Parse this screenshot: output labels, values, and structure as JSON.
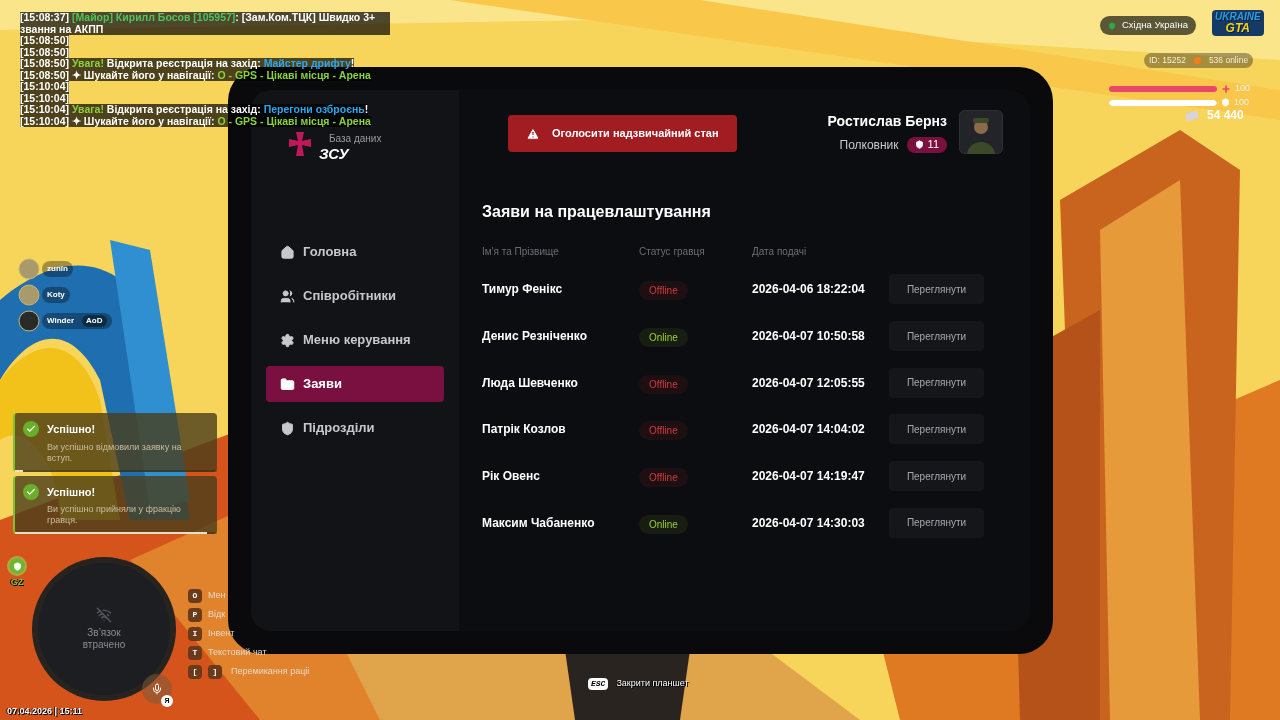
{
  "chat": [
    [
      {
        "text": "[15:08:37] ",
        "kind": "plain"
      },
      {
        "text": "[Майор]  Кирилл Босов [105957]",
        "kind": "player"
      },
      {
        "text": ": [Зам.Ком.ТЦК] Швидко 3+ звання на АКПП",
        "kind": "plain"
      }
    ],
    [
      {
        "text": "[15:08:50]",
        "kind": "plain"
      }
    ],
    [
      {
        "text": "[15:08:50]",
        "kind": "plain"
      }
    ],
    [
      {
        "text": "[15:08:50] ",
        "kind": "plain"
      },
      {
        "text": "Увага!",
        "kind": "alert"
      },
      {
        "text": " Відкрита реєстрація на захід: ",
        "kind": "plain"
      },
      {
        "text": "Майстер дрифту",
        "kind": "event"
      },
      {
        "text": "!",
        "kind": "plain"
      }
    ],
    [
      {
        "text": "[15:08:50] ✦  Шукайте його у навігації: ",
        "kind": "plain"
      },
      {
        "text": "O - GPS - Цікаві місця - Арена",
        "kind": "alert"
      }
    ],
    [
      {
        "text": "[15:10:04]",
        "kind": "plain"
      }
    ],
    [
      {
        "text": "[15:10:04]",
        "kind": "plain"
      }
    ],
    [
      {
        "text": "[15:10:04] ",
        "kind": "plain"
      },
      {
        "text": "Увага!",
        "kind": "alert"
      },
      {
        "text": " Відкрита реєстрація на захід: ",
        "kind": "plain"
      },
      {
        "text": "Перегони озброєнь",
        "kind": "event"
      },
      {
        "text": "!",
        "kind": "plain"
      }
    ],
    [
      {
        "text": "[15:10:04] ✦  Шукайте його у навігації: ",
        "kind": "plain"
      },
      {
        "text": "O - GPS - Цікаві місця - Арена",
        "kind": "alert"
      }
    ]
  ],
  "players": [
    {
      "name": "zunin"
    },
    {
      "name": "Koty"
    },
    {
      "name": "Winder",
      "tag": "AoD"
    }
  ],
  "toasts": [
    {
      "title": "Успішно!",
      "text": "Ви успішно відмовили заявку на вступ.",
      "level": 0.04
    },
    {
      "title": "Успішно!",
      "text": "Ви успішно прийняли у фракцію гравця.",
      "level": 0.95
    }
  ],
  "zone": "GZ",
  "radar": {
    "text": "Зв’язок втрачено",
    "badge": "Я"
  },
  "datetime": "07.04.2026 | 15:11",
  "hints": [
    {
      "keys": [
        "O"
      ],
      "label": "Мен"
    },
    {
      "keys": [
        "P"
      ],
      "label": "Відк"
    },
    {
      "keys": [
        "I"
      ],
      "label": "Інвент"
    },
    {
      "keys": [
        "T"
      ],
      "label": "Текстовий чат"
    },
    {
      "keys": [
        "[",
        "]"
      ],
      "label": "Перемикання раціі"
    }
  ],
  "esc_hint": {
    "key": "ESC",
    "label": "Закрити планшет"
  },
  "hud": {
    "region": "Східна Україна",
    "logo": [
      "UKRAINE",
      "GTA"
    ],
    "id": "ID: 15252",
    "online": "536 online",
    "health": {
      "level": 1,
      "reading": "100"
    },
    "armor": {
      "level": 1,
      "reading": "100"
    },
    "money": "54 440"
  },
  "tablet": {
    "logo": {
      "subtitle": "База даних",
      "title": "ЗСУ"
    },
    "alert_button": "Оголосити надзвичайний стан",
    "user": {
      "name": "Ростислав Бернз",
      "rank": "Полковник",
      "level": "11"
    },
    "nav": [
      {
        "label": "Головна",
        "selected": false
      },
      {
        "label": "Співробітники",
        "selected": false
      },
      {
        "label": "Меню керування",
        "selected": false
      },
      {
        "label": "Заяви",
        "selected": true
      },
      {
        "label": "Підрозділи",
        "selected": false
      }
    ],
    "title": "Заяви на працевлаштування",
    "columns": [
      "Ім'я та Прізвище",
      "Статус гравця",
      "Дата подачі"
    ],
    "rows": [
      {
        "name": "Тимур Фенікс",
        "status": "Offline",
        "online": false,
        "date": "2026-04-06 18:22:04",
        "action": "Переглянути"
      },
      {
        "name": "Денис Резніченко",
        "status": "Online",
        "online": true,
        "date": "2026-04-07 10:50:58",
        "action": "Переглянути"
      },
      {
        "name": "Люда Шевченко",
        "status": "Offline",
        "online": false,
        "date": "2026-04-07 12:05:55",
        "action": "Переглянути"
      },
      {
        "name": "Патрік Козлов",
        "status": "Offline",
        "online": false,
        "date": "2026-04-07 14:04:02",
        "action": "Переглянути"
      },
      {
        "name": "Рік Овенс",
        "status": "Offline",
        "online": false,
        "date": "2026-04-07 14:19:47",
        "action": "Переглянути"
      },
      {
        "name": "Максим Чабаненко",
        "status": "Online",
        "online": true,
        "date": "2026-04-07 14:30:03",
        "action": "Переглянути"
      }
    ]
  }
}
